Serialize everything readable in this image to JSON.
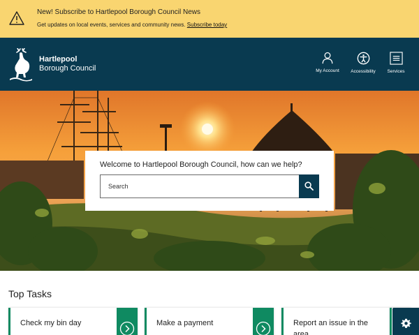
{
  "alert": {
    "title": "New! Subscribe to Hartlepool Borough Council News",
    "body": "Get updates on local events, services and community news.",
    "link": "Subscribe today",
    "icon": "warning-icon"
  },
  "header": {
    "brand_line1": "Hartlepool",
    "brand_line2": "Borough Council",
    "nav": [
      {
        "label": "My Account",
        "icon": "user-icon"
      },
      {
        "label": "Accessibility",
        "icon": "accessibility-icon"
      },
      {
        "label": "Services",
        "icon": "menu-icon"
      }
    ]
  },
  "hero": {
    "search_title": "Welcome to Hartlepool Borough Council, how can we help?",
    "search_placeholder": "Search"
  },
  "top_tasks": {
    "heading": "Top Tasks",
    "items": [
      {
        "label": "Check my bin day"
      },
      {
        "label": "Make a payment"
      },
      {
        "label": "Report an issue in the area"
      }
    ]
  },
  "colors": {
    "alert_bg": "#f9d570",
    "header_bg": "#093a50",
    "accent_green": "#0f8a61"
  }
}
